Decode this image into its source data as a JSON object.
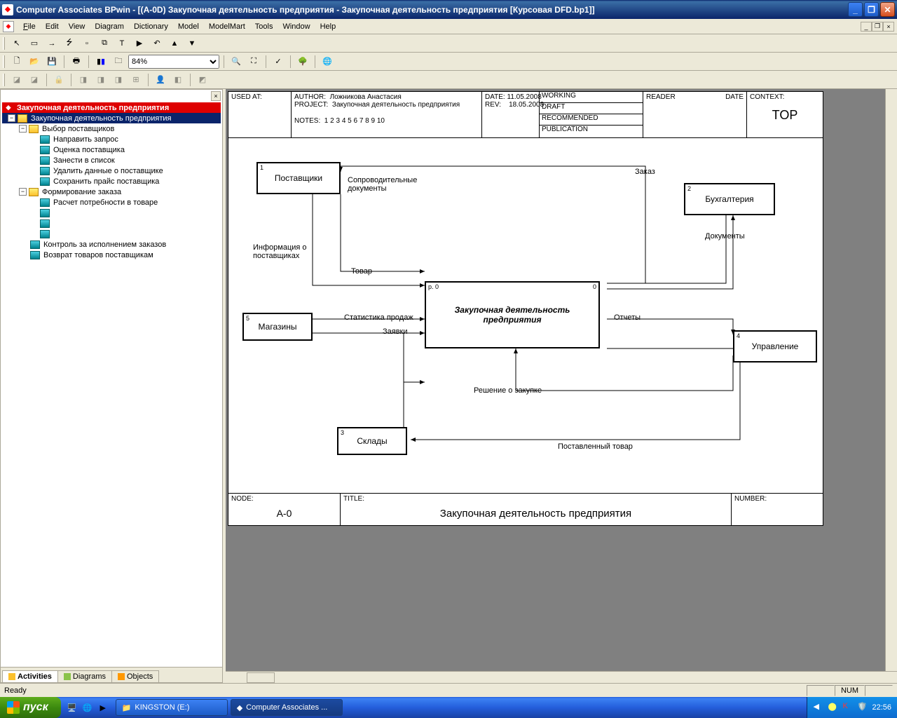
{
  "window": {
    "title": "Computer Associates BPwin - [(A-0D) Закупочная деятельность  предприятия - Закупочная деятельность предприятия  [Курсовая DFD.bp1]]"
  },
  "menu": {
    "file": "File",
    "edit": "Edit",
    "view": "View",
    "diagram": "Diagram",
    "dictionary": "Dictionary",
    "model": "Model",
    "modelmart": "ModelMart",
    "tools": "Tools",
    "window": "Window",
    "help": "Help"
  },
  "toolbars": {
    "zoom_value": "84%"
  },
  "tree": {
    "root": "Закупочная деятельность предприятия",
    "n1": "Закупочная деятельность  предприятия",
    "n2": "Выбор поставщиков",
    "n2_1": "Направить запрос",
    "n2_2": "Оценка поставщика",
    "n2_3": "Занести в список",
    "n2_4": "Удалить данные о поставщике",
    "n2_5": "Сохранить прайс поставщика",
    "n3": "Формирование заказа",
    "n3_1": "Расчет потребности в товаре",
    "n4": "Контроль за исполнением заказов",
    "n5": "Возврат товаров поставщикам"
  },
  "tabs": {
    "activities": "Activities",
    "diagrams": "Diagrams",
    "objects": "Objects"
  },
  "header": {
    "used_at": "USED AT:",
    "author_lbl": "AUTHOR:",
    "author": "Ложникова Анастасия",
    "project_lbl": "PROJECT:",
    "project": "Закупочная деятельность предприятия",
    "notes_lbl": "NOTES:",
    "notes": "1  2  3  4  5  6  7  8  9  10",
    "date_lbl": "DATE:",
    "date": "11.05.2008",
    "rev_lbl": "REV:",
    "rev": "18.05.2008",
    "working": "WORKING",
    "draft": "DRAFT",
    "recommended": "RECOMMENDED",
    "publication": "PUBLICATION",
    "reader": "READER",
    "date2": "DATE",
    "context_lbl": "CONTEXT:",
    "context": "TOP"
  },
  "diagram": {
    "e1": "Поставщики",
    "e1n": "1",
    "e2": "Бухгалтерия",
    "e2n": "2",
    "e3": "Склады",
    "e3n": "3",
    "e4": "Управление",
    "e4n": "4",
    "e5": "Магазины",
    "e5n": "5",
    "p0": "Закупочная деятельность предприятия",
    "p0_left": "p. 0",
    "p0_right": "0",
    "a_docs": "Сопроводительные документы",
    "a_info": "Информация о поставщиках",
    "a_tovar": "Товар",
    "a_zakaz": "Заказ",
    "a_doc2": "Документы",
    "a_stat": "Статистика продаж",
    "a_zayavki": "Заявки",
    "a_otchety": "Отчеты",
    "a_reshenie": "Решение о закупке",
    "a_post_tovar": "Поставленный товар"
  },
  "footer": {
    "node_lbl": "NODE:",
    "node": "A-0",
    "title_lbl": "TITLE:",
    "title": "Закупочная деятельность  предприятия",
    "number_lbl": "NUMBER:"
  },
  "statusbar": {
    "ready": "Ready",
    "num": "NUM"
  },
  "taskbar": {
    "start": "пуск",
    "task1": "KINGSTON (E:)",
    "task2": "Computer Associates ...",
    "clock": "22:56"
  }
}
